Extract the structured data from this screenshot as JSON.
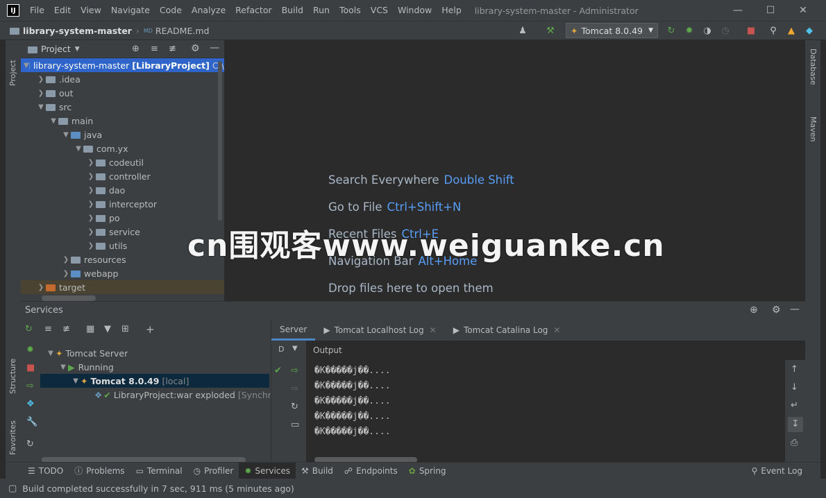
{
  "window": {
    "title": "library-system-master - Administrator",
    "menu": [
      "File",
      "Edit",
      "View",
      "Navigate",
      "Code",
      "Analyze",
      "Refactor",
      "Build",
      "Run",
      "Tools",
      "VCS",
      "Window",
      "Help"
    ]
  },
  "navbar": {
    "project": "library-system-master",
    "file": "README.md",
    "run_config": "Tomcat 8.0.49"
  },
  "left_strip": {
    "project": "Project",
    "structure": "Structure",
    "favorites": "Favorites"
  },
  "right_strip": {
    "database": "Database",
    "maven": "Maven"
  },
  "project_panel": {
    "title": "Project",
    "root": {
      "name": "library-system-master",
      "module": "[LibraryProject]",
      "path": "C:\\"
    },
    "items": [
      {
        "label": ".idea"
      },
      {
        "label": "out"
      },
      {
        "label": "src"
      },
      {
        "label": "main"
      },
      {
        "label": "java"
      },
      {
        "label": "com.yx"
      },
      {
        "label": "codeutil"
      },
      {
        "label": "controller"
      },
      {
        "label": "dao"
      },
      {
        "label": "interceptor"
      },
      {
        "label": "po"
      },
      {
        "label": "service"
      },
      {
        "label": "utils"
      },
      {
        "label": "resources"
      },
      {
        "label": "webapp"
      },
      {
        "label": "target"
      }
    ]
  },
  "editor": {
    "hints": [
      {
        "text": "Search Everywhere",
        "key": "Double Shift"
      },
      {
        "text": "Go to File",
        "key": "Ctrl+Shift+N"
      },
      {
        "text": "Recent Files",
        "key": "Ctrl+E"
      },
      {
        "text": "Navigation Bar",
        "key": "Alt+Home"
      },
      {
        "text": "Drop files here to open them",
        "key": ""
      }
    ]
  },
  "watermark": "cn围观客www.weiguanke.cn",
  "services": {
    "title": "Services",
    "tree": {
      "server": "Tomcat Server",
      "state": "Running",
      "instance": "Tomcat 8.0.49",
      "instance_tag": "[local]",
      "artifact": "LibraryProject:war exploded",
      "artifact_tag": "[Synchro"
    },
    "tabs": [
      "Server",
      "Tomcat Localhost Log",
      "Tomcat Catalina Log"
    ],
    "output_header": "Output",
    "output_lines": [
      "�K�����j��....",
      "�K�����j��....",
      "�K�����j��....",
      "�K�����j��....",
      "�K�����j��...."
    ]
  },
  "bottom_tools": [
    "TODO",
    "Problems",
    "Terminal",
    "Profiler",
    "Services",
    "Build",
    "Endpoints",
    "Spring"
  ],
  "event_log": "Event Log",
  "status": "Build completed successfully in 7 sec, 911 ms (5 minutes ago)"
}
